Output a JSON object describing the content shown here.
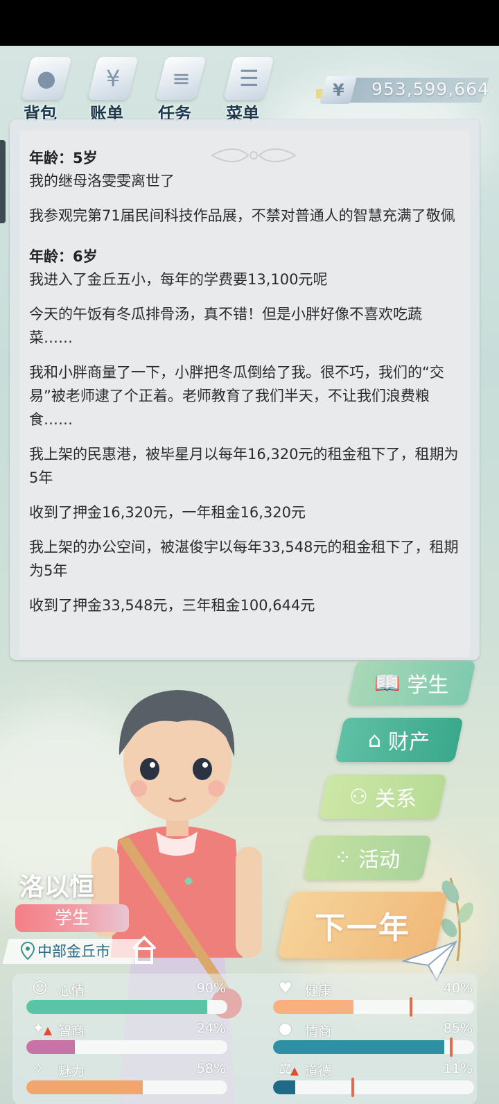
{
  "nav": {
    "items": [
      {
        "label": "背包",
        "icon": "bag-icon"
      },
      {
        "label": "账单",
        "icon": "bill-icon"
      },
      {
        "label": "任务",
        "icon": "task-icon"
      },
      {
        "label": "菜单",
        "icon": "menu-icon"
      }
    ],
    "money": {
      "symbol": "¥",
      "value": "953,599,664"
    }
  },
  "log": {
    "entries": [
      {
        "age": "年龄：5岁",
        "lines": [
          "我的继母洛雯雯离世了",
          "我参观完第71届民间科技作品展，不禁对普通人的智慧充满了敬佩"
        ]
      },
      {
        "age": "年龄：6岁",
        "lines": [
          "我进入了金丘五小，每年的学费要13,100元呢",
          "今天的午饭有冬瓜排骨汤，真不错！但是小胖好像不喜欢吃蔬菜……",
          "我和小胖商量了一下，小胖把冬瓜倒给了我。很不巧，我们的“交易”被老师逮了个正着。老师教育了我们半天，不让我们浪费粮食……",
          "我上架的民惠港，被毕星月以每年16,320元的租金租下了，租期为5年",
          "收到了押金16,320元，一年租金16,320元",
          "我上架的办公空间，被湛俊宇以每年33,548元的租金租下了，租期为5年",
          "收到了押金33,548元，三年租金100,644元"
        ]
      }
    ]
  },
  "actions": {
    "student": "学生",
    "assets": "财产",
    "relations": "关系",
    "activities": "活动",
    "next_year": "下一年"
  },
  "character": {
    "name": "洛以恒",
    "role": "学生",
    "location": "中部金丘市"
  },
  "stats": [
    {
      "label": "心情",
      "value": 0.9,
      "display": "90%",
      "color": "#5cc4a6",
      "icon": "smile-icon",
      "warn": false,
      "marker": false
    },
    {
      "label": "健康",
      "value": 0.4,
      "display": "40%",
      "color": "#f7b07e",
      "icon": "heart-icon",
      "warn": false,
      "marker": true
    },
    {
      "label": "智商",
      "value": 0.24,
      "display": "24%",
      "color": "#c873a8",
      "icon": "bulb-icon",
      "warn": true,
      "marker": false
    },
    {
      "label": "情商",
      "value": 0.85,
      "display": "85%",
      "color": "#2f8fa4",
      "icon": "apple-icon",
      "warn": false,
      "marker": true
    },
    {
      "label": "魅力",
      "value": 0.58,
      "display": "58%",
      "color": "#f3a56e",
      "icon": "sparkle-icon",
      "warn": false,
      "marker": false
    },
    {
      "label": "道德",
      "value": 0.11,
      "display": "11%",
      "color": "#1f6a86",
      "icon": "scale-icon",
      "warn": true,
      "marker": true
    }
  ]
}
